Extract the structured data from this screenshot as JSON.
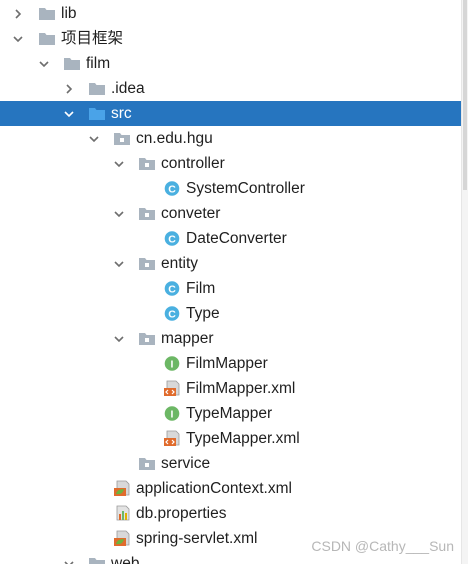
{
  "tree": {
    "lib": "lib",
    "project": "项目框架",
    "film": "film",
    "idea": ".idea",
    "src": "src",
    "package": "cn.edu.hgu",
    "controller": "controller",
    "system_controller": "SystemController",
    "conveter": "conveter",
    "date_converter": "DateConverter",
    "entity": "entity",
    "film_class": "Film",
    "type_class": "Type",
    "mapper": "mapper",
    "film_mapper": "FilmMapper",
    "film_mapper_xml": "FilmMapper.xml",
    "type_mapper": "TypeMapper",
    "type_mapper_xml": "TypeMapper.xml",
    "service": "service",
    "application_context": "applicationContext.xml",
    "db_properties": "db.properties",
    "spring_servlet": "spring-servlet.xml",
    "web": "web"
  },
  "icons": {
    "folder": "folder-icon",
    "package": "package-icon",
    "class": "class-icon",
    "interface": "interface-icon",
    "xml": "xml-file-icon",
    "spring_xml": "spring-xml-icon",
    "properties": "properties-file-icon"
  },
  "colors": {
    "selection": "#2675bf",
    "class_icon": "#4ab0e0",
    "interface_icon": "#6cb765",
    "folder": "#a9b4bf",
    "source_folder": "#3d8fcd"
  },
  "watermark": "CSDN @Cathy___Sun"
}
